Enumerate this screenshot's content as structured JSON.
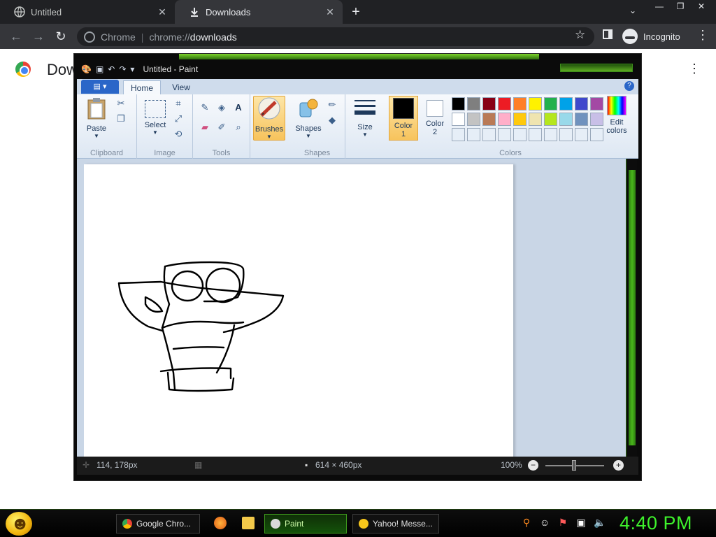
{
  "browser": {
    "tabs": [
      {
        "label": "Untitled",
        "active": false
      },
      {
        "label": "Downloads",
        "active": true
      }
    ],
    "omnibox": {
      "chip": "Chrome",
      "scheme": "chrome://",
      "host": "downloads"
    },
    "incognito_label": "Incognito",
    "page_title": "Dow"
  },
  "paint": {
    "window_title": "Untitled - Paint",
    "ribbon_tabs": [
      "Home",
      "View"
    ],
    "groups": {
      "clipboard": {
        "label": "Clipboard",
        "paste": "Paste"
      },
      "image": {
        "label": "Image",
        "select": "Select"
      },
      "tools": {
        "label": "Tools"
      },
      "brushes": {
        "label": "Brushes"
      },
      "shapes": {
        "label": "Shapes",
        "button": "Shapes"
      },
      "size": {
        "label": "Size"
      },
      "colors": {
        "label": "Colors",
        "color1_line1": "Color",
        "color1_line2": "1",
        "color2_line1": "Color",
        "color2_line2": "2",
        "edit_line1": "Edit",
        "edit_line2": "colors",
        "palette_row1": [
          "#000000",
          "#7f7f7f",
          "#880015",
          "#ed1c24",
          "#ff7f27",
          "#fff200",
          "#22b14c",
          "#00a2e8",
          "#3f48cc",
          "#a349a4"
        ],
        "palette_row2": [
          "#ffffff",
          "#c3c3c3",
          "#b97a57",
          "#ffaec9",
          "#ffc90e",
          "#efe4b0",
          "#b5e61d",
          "#99d9ea",
          "#7092be",
          "#c8bfe7"
        ],
        "palette_row3": [
          "#e6eef7",
          "#e6eef7",
          "#e6eef7",
          "#e6eef7",
          "#e6eef7",
          "#e6eef7",
          "#e6eef7",
          "#e6eef7",
          "#e6eef7",
          "#e6eef7"
        ]
      }
    },
    "status": {
      "cursor_pos": "114, 178px",
      "canvas_size": "614 × 460px",
      "zoom": "100%"
    }
  },
  "taskbar": {
    "tasks": [
      {
        "label": "Google Chro...",
        "active": false
      },
      {
        "label": "Paint",
        "active": true
      },
      {
        "label": "Yahoo! Messe...",
        "active": false
      }
    ],
    "clock": "4:40 PM"
  }
}
